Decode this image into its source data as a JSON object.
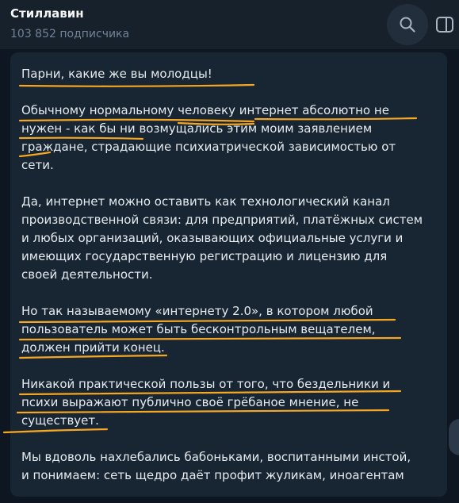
{
  "channel": {
    "title": "Стиллавин",
    "subscribers": "103 852 подписчика"
  },
  "icons": {
    "search": "search-icon",
    "side_panel": "side-panel-icon"
  },
  "message": {
    "paragraphs": [
      "Парни, какие же вы молодцы!",
      "Обычному нормальному человеку интернет абсолютно не\nнужен - как бы ни возмущались этим моим заявлением\nграждане, страдающие психиатрической зависимостью от\nсети.",
      "Да, интернет можно оставить как технологический канал\nпроизводственной связи: для предприятий, платёжных систем\nи любых организаций, оказывающих официальные услуги и\nимеющих государственную регистрацию и лицензию для\nсвоей деятельности.",
      "Но так называемому «интернету 2.0», в котором любой\nпользователь может быть бесконтрольным вещателем,\nдолжен прийти конец.",
      "Никакой практической пользы от того, что бездельники и\nпсихи выражают публично своё грёбаное мнение, не\nсуществует.",
      "Мы вдоволь нахлебались бабоньками, воспитанными инстой,\nи понимаем: сеть щедро даёт профит жуликам, иноагентам"
    ]
  },
  "colors": {
    "header_bg": "#17212b",
    "chat_bg": "#0e1621",
    "message_bg": "#182533",
    "text": "#e6ebef",
    "muted": "#708499",
    "underline": "#f5a623"
  }
}
